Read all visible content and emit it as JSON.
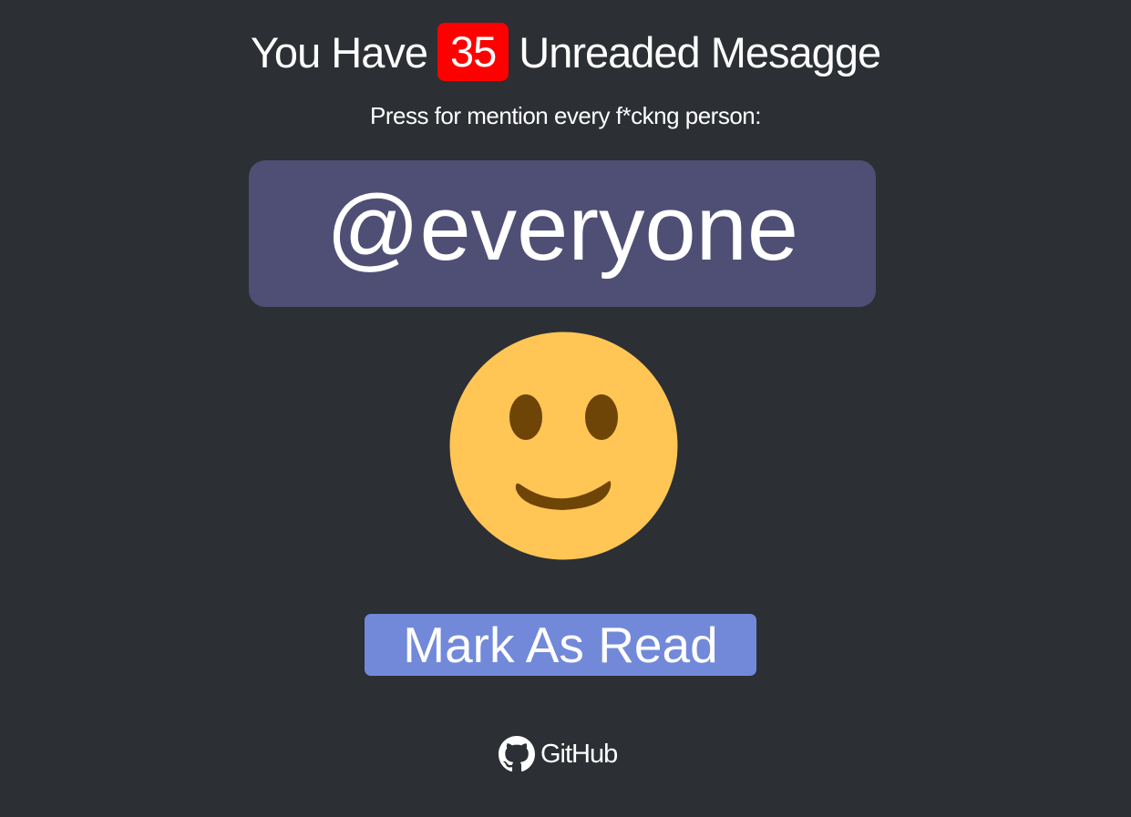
{
  "header": {
    "prefix": "You Have",
    "unread_count": "35",
    "suffix": "Unreaded Mesagge"
  },
  "subtitle": "Press for mention every f*ckng person:",
  "mention_button": {
    "label": "@everyone"
  },
  "smiley": {
    "icon": "slightly-smiling-face-icon",
    "face_color": "#FFC555",
    "feature_color": "#6E4407"
  },
  "mark_read_button": {
    "label": "Mark As Read"
  },
  "footer": {
    "link_label": "GitHub",
    "icon": "github-icon"
  },
  "colors": {
    "background": "#2C2F33",
    "badge": "#FF0000",
    "mention_button": "#4F4F75",
    "mark_read_button": "#7289DA"
  }
}
